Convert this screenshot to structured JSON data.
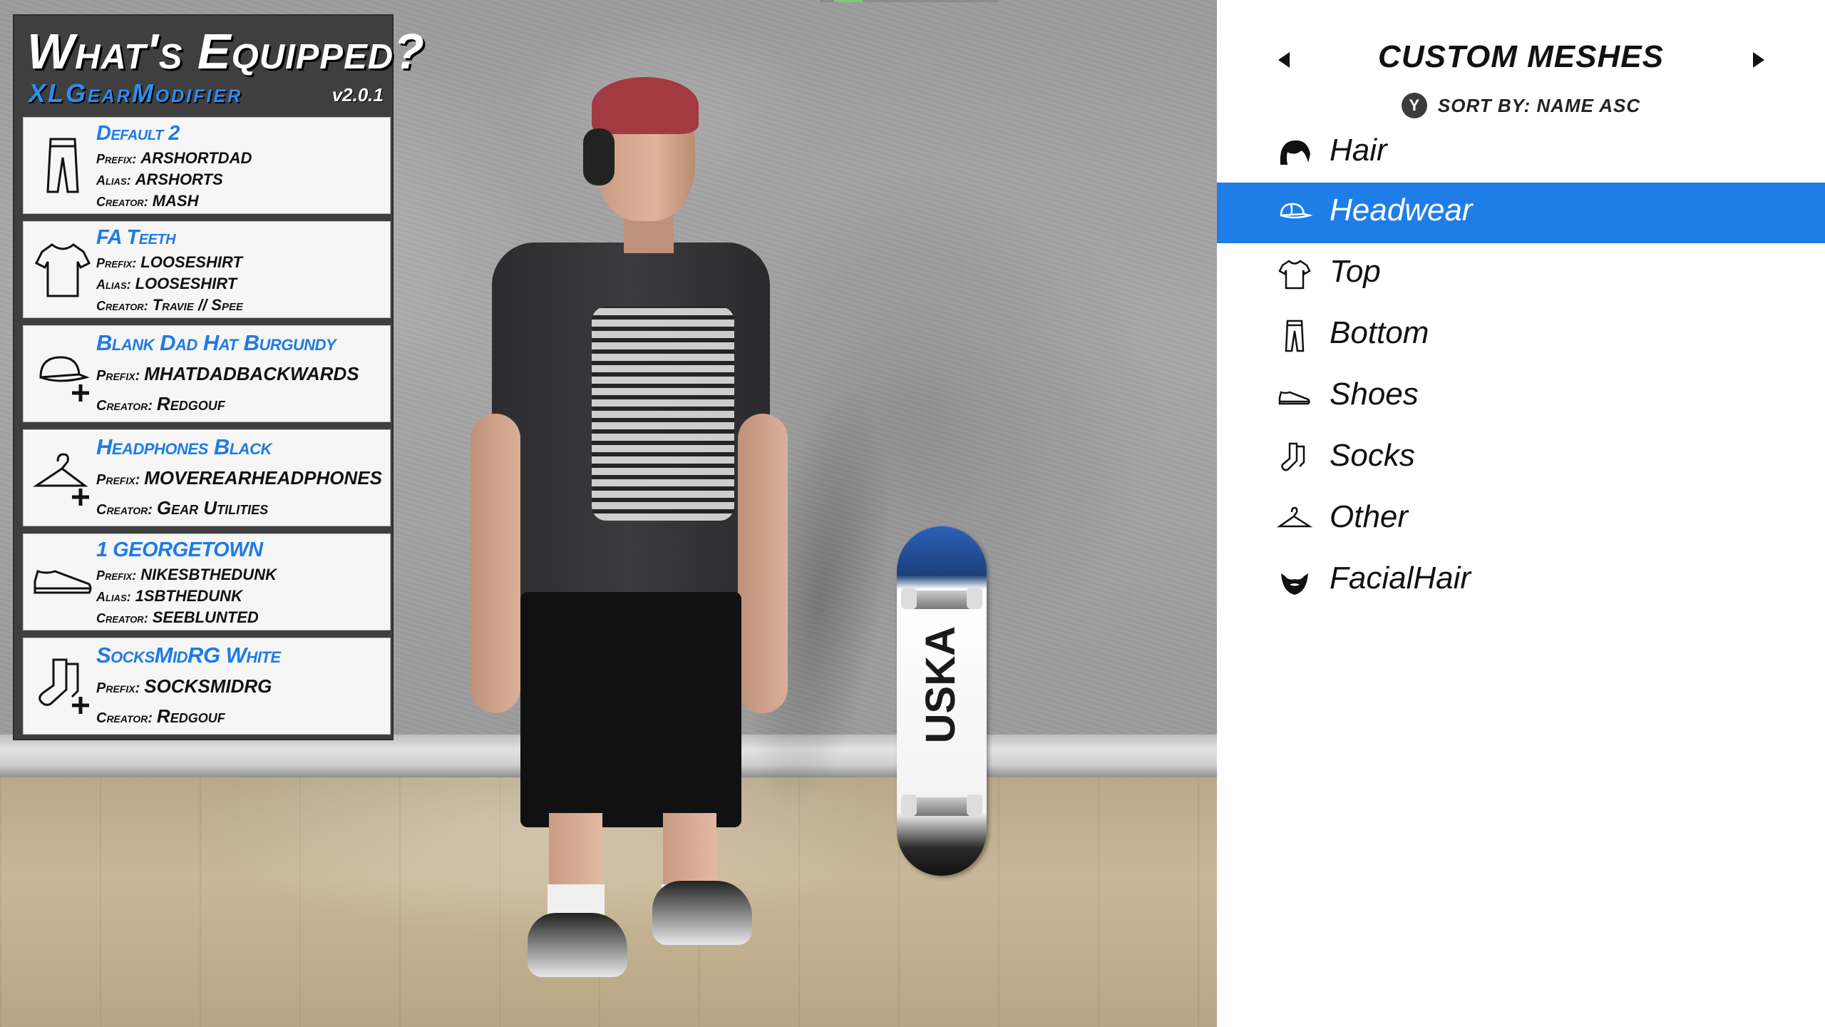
{
  "equipped_panel": {
    "title": "What's Equipped?",
    "subtitle": "XLGearModifier",
    "version": "v2.0.1",
    "items": [
      {
        "name": "Default 2",
        "icon": "pants-icon",
        "prefix_label": "Prefix:",
        "prefix": "ARSHORTDAD",
        "alias_label": "Alias:",
        "alias": "ARSHORTS",
        "creator_label": "Creator:",
        "creator": "MASH"
      },
      {
        "name": "FA Teeth",
        "icon": "tshirt-icon",
        "prefix_label": "Prefix:",
        "prefix": "LOOSESHIRT",
        "alias_label": "Alias:",
        "alias": "LOOSESHIRT",
        "creator_label": "Creator:",
        "creator": "Travie // Spee"
      },
      {
        "name": "Blank Dad Hat Burgundy",
        "icon": "cap-plus-icon",
        "prefix_label": "Prefix:",
        "prefix": "MHATDADBACKWARDS",
        "creator_label": "Creator:",
        "creator": "Redgouf"
      },
      {
        "name": "Headphones Black",
        "icon": "hanger-plus-icon",
        "prefix_label": "Prefix:",
        "prefix": "MOVEREARHEADPHONES",
        "creator_label": "Creator:",
        "creator": "Gear Utilities"
      },
      {
        "name": "1 GEORGETOWN",
        "icon": "shoe-icon",
        "prefix_label": "Prefix:",
        "prefix": "NIKESBTHEDUNK",
        "alias_label": "Alias:",
        "alias": "1SBTHEDUNK",
        "creator_label": "Creator:",
        "creator": "SEEBLUNTED"
      },
      {
        "name": "SocksMidRG White",
        "icon": "socks-plus-icon",
        "prefix_label": "Prefix:",
        "prefix": "SOCKSMIDRG",
        "creator_label": "Creator:",
        "creator": "Redgouf"
      }
    ]
  },
  "mesh_panel": {
    "title": "CUSTOM MESHES",
    "sort_button": "Y",
    "sort_label": "SORT BY: NAME ASC",
    "selected_index": 1,
    "accent_color": "#1e7ee8",
    "items": [
      {
        "label": "Hair",
        "icon": "hair-icon"
      },
      {
        "label": "Headwear",
        "icon": "cap-icon"
      },
      {
        "label": "Top",
        "icon": "tshirt-icon"
      },
      {
        "label": "Bottom",
        "icon": "pants-icon"
      },
      {
        "label": "Shoes",
        "icon": "shoe-icon"
      },
      {
        "label": "Socks",
        "icon": "socks-icon"
      },
      {
        "label": "Other",
        "icon": "hanger-icon"
      },
      {
        "label": "FacialHair",
        "icon": "beard-icon"
      }
    ]
  },
  "scene": {
    "deck_graphic_text": "USKA"
  }
}
